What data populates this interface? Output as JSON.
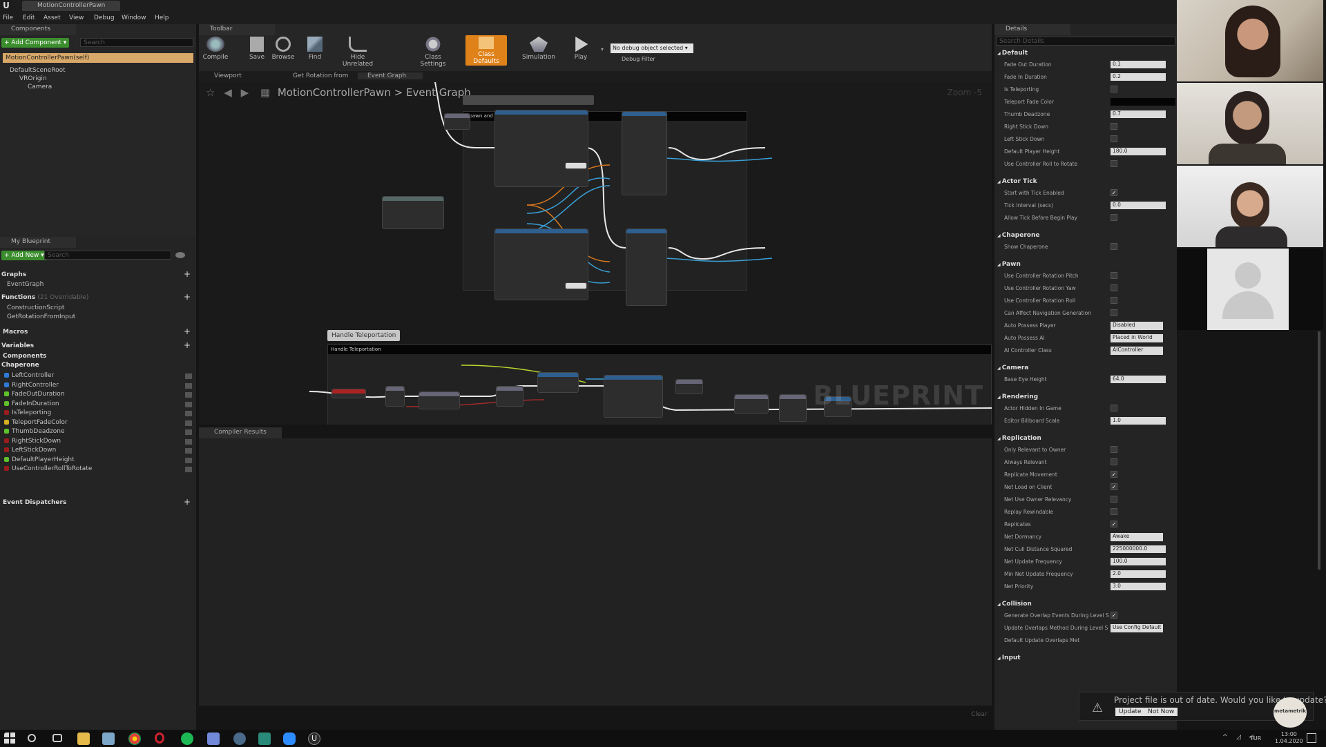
{
  "window": {
    "doc_tab": "MotionControllerPawn"
  },
  "menu": [
    "File",
    "Edit",
    "Asset",
    "View",
    "Debug",
    "Window",
    "Help"
  ],
  "components": {
    "tab": "Components",
    "add_button": "+ Add Component ▾",
    "search_placeholder": "Search",
    "self_row": "MotionControllerPawn(self)",
    "tree": [
      "DefaultSceneRoot",
      "VROrigin",
      "Camera"
    ]
  },
  "my_blueprint": {
    "tab": "My Blueprint",
    "add_new": "+ Add New ▾",
    "search_placeholder": "Search",
    "graphs_head": "Graphs",
    "graphs": [
      "EventGraph"
    ],
    "functions_head": "Functions",
    "functions_note": "(21 Overridable)",
    "functions": [
      "ConstructionScript",
      "GetRotationFromInput"
    ],
    "macros_head": "Macros",
    "variables_head": "Variables",
    "components_head": "Components",
    "chaperone_head": "Chaperone",
    "variables": [
      {
        "name": "LeftController",
        "color": "#2e7bd6"
      },
      {
        "name": "RightController",
        "color": "#2e7bd6"
      },
      {
        "name": "FadeOutDuration",
        "color": "#5ec22b"
      },
      {
        "name": "FadeInDuration",
        "color": "#5ec22b"
      },
      {
        "name": "IsTeleporting",
        "color": "#9a1c1c"
      },
      {
        "name": "TeleportFadeColor",
        "color": "#d6b024"
      },
      {
        "name": "ThumbDeadzone",
        "color": "#5ec22b"
      },
      {
        "name": "RightStickDown",
        "color": "#9a1c1c"
      },
      {
        "name": "LeftStickDown",
        "color": "#9a1c1c"
      },
      {
        "name": "DefaultPlayerHeight",
        "color": "#5ec22b"
      },
      {
        "name": "UseControllerRollToRotate",
        "color": "#9a1c1c"
      }
    ],
    "dispatchers_head": "Event Dispatchers"
  },
  "toolbar": {
    "tab": "Toolbar",
    "buttons": [
      "Compile",
      "Save",
      "Browse",
      "Find",
      "Hide Unrelated",
      "Class Settings",
      "Class Defaults",
      "Simulation",
      "Play"
    ],
    "debug_select": "No debug object selected ▾",
    "debug_filter": "Debug Filter"
  },
  "graph": {
    "tabs": [
      "Viewport",
      "Get Rotation from",
      "Event Graph"
    ],
    "breadcrumb_root": "MotionControllerPawn",
    "breadcrumb_sep": ">",
    "breadcrumb_leaf": "Event Graph",
    "zoom": "Zoom -5",
    "comment1": "Spawn and attach both motion controllers",
    "comment2_label": "Handle Teleportation",
    "comment2": "Handle Teleportation",
    "watermark": "BLUEPRINT"
  },
  "compiler": {
    "tab": "Compiler Results",
    "clear": "Clear"
  },
  "details": {
    "tab": "Details",
    "search_placeholder": "Search Details",
    "rows": [
      {
        "type": "cat",
        "label": "Default"
      },
      {
        "type": "num",
        "label": "Fade Out Duration",
        "value": "0.1"
      },
      {
        "type": "num",
        "label": "Fade In Duration",
        "value": "0.2"
      },
      {
        "type": "check",
        "label": "Is Teleporting",
        "checked": false
      },
      {
        "type": "color",
        "label": "Teleport Fade Color"
      },
      {
        "type": "num",
        "label": "Thumb Deadzone",
        "value": "0.7"
      },
      {
        "type": "check",
        "label": "Right Stick Down",
        "checked": false
      },
      {
        "type": "check",
        "label": "Left Stick Down",
        "checked": false
      },
      {
        "type": "num",
        "label": "Default Player Height",
        "value": "180.0"
      },
      {
        "type": "check",
        "label": "Use Controller Roll to Rotate",
        "checked": false
      },
      {
        "type": "gap"
      },
      {
        "type": "cat",
        "label": "Actor Tick"
      },
      {
        "type": "check",
        "label": "Start with Tick Enabled",
        "checked": true
      },
      {
        "type": "num",
        "label": "Tick Interval (secs)",
        "value": "0.0"
      },
      {
        "type": "check",
        "label": "Allow Tick Before Begin Play",
        "checked": false
      },
      {
        "type": "gap"
      },
      {
        "type": "cat",
        "label": "Chaperone"
      },
      {
        "type": "check",
        "label": "Show Chaperone",
        "checked": false
      },
      {
        "type": "gap"
      },
      {
        "type": "cat",
        "label": "Pawn"
      },
      {
        "type": "check",
        "label": "Use Controller Rotation Pitch",
        "checked": false
      },
      {
        "type": "check",
        "label": "Use Controller Rotation Yaw",
        "checked": false
      },
      {
        "type": "check",
        "label": "Use Controller Rotation Roll",
        "checked": false
      },
      {
        "type": "check",
        "label": "Can Affect Navigation Generation",
        "checked": false
      },
      {
        "type": "combo",
        "label": "Auto Possess Player",
        "value": "Disabled"
      },
      {
        "type": "combo",
        "label": "Auto Possess AI",
        "value": "Placed in World"
      },
      {
        "type": "combo",
        "label": "AI Controller Class",
        "value": "AIController"
      },
      {
        "type": "gap"
      },
      {
        "type": "cat",
        "label": "Camera"
      },
      {
        "type": "num",
        "label": "Base Eye Height",
        "value": "64.0"
      },
      {
        "type": "gap"
      },
      {
        "type": "cat",
        "label": "Rendering"
      },
      {
        "type": "check",
        "label": "Actor Hidden In Game",
        "checked": false
      },
      {
        "type": "num",
        "label": "Editor Billboard Scale",
        "value": "1.0"
      },
      {
        "type": "gap"
      },
      {
        "type": "cat",
        "label": "Replication"
      },
      {
        "type": "check",
        "label": "Only Relevant to Owner",
        "checked": false
      },
      {
        "type": "check",
        "label": "Always Relevant",
        "checked": false
      },
      {
        "type": "check",
        "label": "Replicate Movement",
        "checked": true
      },
      {
        "type": "check",
        "label": "Net Load on Client",
        "checked": true
      },
      {
        "type": "check",
        "label": "Net Use Owner Relevancy",
        "checked": false
      },
      {
        "type": "check",
        "label": "Replay Rewindable",
        "checked": false
      },
      {
        "type": "check",
        "label": "Replicates",
        "checked": true
      },
      {
        "type": "combo",
        "label": "Net Dormancy",
        "value": "Awake"
      },
      {
        "type": "num",
        "label": "Net Cull Distance Squared",
        "value": "225000000.0"
      },
      {
        "type": "num",
        "label": "Net Update Frequency",
        "value": "100.0"
      },
      {
        "type": "num",
        "label": "Min Net Update Frequency",
        "value": "2.0"
      },
      {
        "type": "num",
        "label": "Net Priority",
        "value": "3.0"
      },
      {
        "type": "gap"
      },
      {
        "type": "cat",
        "label": "Collision"
      },
      {
        "type": "check",
        "label": "Generate Overlap Events During Level S",
        "checked": true
      },
      {
        "type": "combo",
        "label": "Update Overlaps Method During Level S",
        "value": "Use Config Default"
      },
      {
        "type": "text",
        "label": "Default Update Overlaps Met"
      },
      {
        "type": "gap"
      },
      {
        "type": "cat",
        "label": "Input"
      }
    ]
  },
  "toast": {
    "message": "Project file is out of date. Would you like to update?",
    "update": "Update",
    "not_now": "Not Now"
  },
  "video_badge": "metametrik",
  "tray": {
    "lang": "TUR",
    "time": "13:00",
    "date": "1.04.2020"
  }
}
